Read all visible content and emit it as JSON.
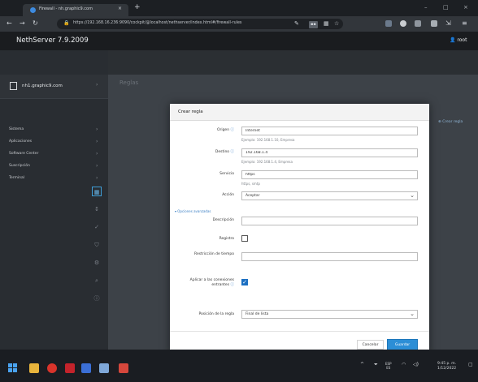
{
  "browser": {
    "tab_title": "Firewall - nh.graphic9.com",
    "tab_close": "×",
    "new_tab": "+",
    "url": "https://192.168.16.236:9090/cockpit/@localhost/nethserver/index.html#/firewall-rules",
    "window_controls": {
      "minimize": "–",
      "maximize": "□",
      "close": "×"
    }
  },
  "app": {
    "brand": "NethServer 7.9.2009",
    "user": "root"
  },
  "sidebar": {
    "host": "nh1.graphic9.com",
    "items": [
      {
        "label": "Sistema"
      },
      {
        "label": "Aplicaciones"
      },
      {
        "label": "Software Center"
      },
      {
        "label": "Suscripción"
      },
      {
        "label": "Terminal"
      }
    ],
    "caret": "›"
  },
  "main": {
    "title": "Reglas",
    "add_link": "Crear regla"
  },
  "modal": {
    "title": "Crear regla",
    "fields": {
      "origin": {
        "label": "Origen",
        "value": "Internet",
        "help": "Ejemplo: 192.168.1.10, Empresa"
      },
      "destination": {
        "label": "Destino",
        "value": "192.168.1.4",
        "help": "Ejemplo: 192.168.1.4, Empresa"
      },
      "service": {
        "label": "Servicio",
        "value": "https",
        "help": "https, smtp"
      },
      "action": {
        "label": "Acción",
        "value": "Aceptar"
      },
      "description": {
        "label": "Descripción",
        "value": ""
      },
      "log": {
        "label": "Registro"
      },
      "time": {
        "label": "Restricción de tiempo",
        "value": ""
      },
      "apply_vpn": {
        "label": "Aplicar a las conexiones entrantes"
      },
      "position": {
        "label": "Posición de la regla",
        "value": "Final de lista"
      }
    },
    "advanced": "Opciones avanzadas",
    "cancel": "Cancelar",
    "save": "Guardar"
  },
  "taskbar": {
    "tray": {
      "chevron": "^",
      "lang": "ESP",
      "lang2": "ES"
    },
    "time": "9:45 p. m.",
    "date": "1/12/2022"
  },
  "colors": {
    "accent": "#2c8ed6",
    "header": "#1a1c1f",
    "sidebar": "#292d32"
  }
}
